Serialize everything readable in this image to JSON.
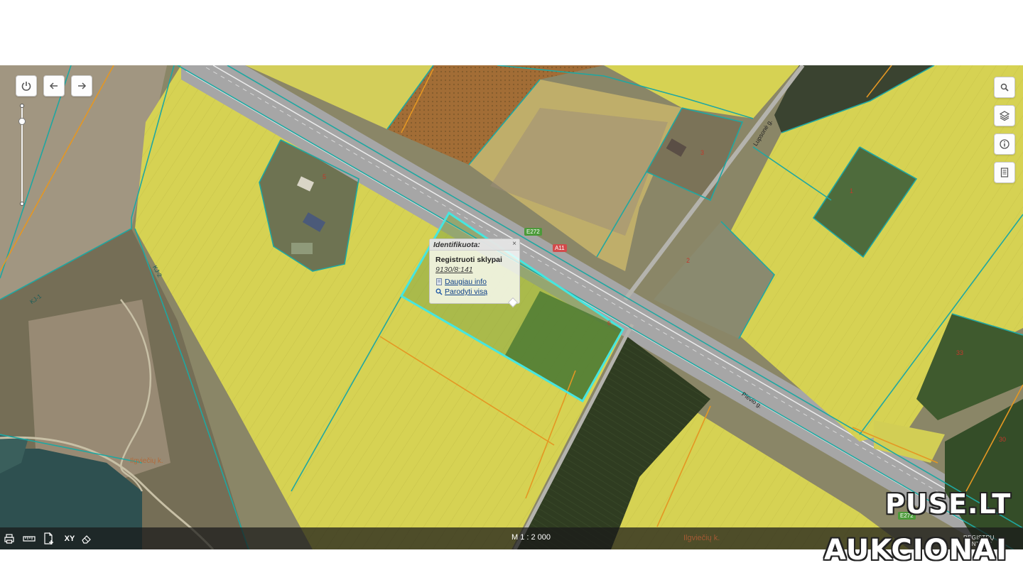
{
  "colors": {
    "canola": "#d6d253",
    "highway": "#a6a6a6",
    "parcel_line": "#1fa7a1",
    "highlight": "#45e6e0",
    "orange_line": "#e49723",
    "water": "#2e5050",
    "dark_field": "#2f3c21"
  },
  "map_controls": {
    "power_icon": "power-icon",
    "back_icon": "arrow-left-icon",
    "forward_icon": "arrow-right-icon",
    "zoom_level": 0.15
  },
  "right_toolbar": {
    "search_icon": "search-icon",
    "layers_icon": "layers-icon",
    "info_icon": "info-icon",
    "legend_icon": "document-icon"
  },
  "popup": {
    "header": "Identifikuota:",
    "close": "×",
    "title": "Registruoti sklypai",
    "parcel_id": "9130/8:141",
    "link_more": "Daugiau info",
    "link_show_all": "Parodyti visą"
  },
  "map_labels": {
    "village": "Ilgviečių k.",
    "road_e272": "E272",
    "road_a11": "A11",
    "road_e272_lower": "E272",
    "street_lupsone": "Lupsonė g.",
    "street_pievio": "Pievio g.",
    "parcel_5": "5",
    "parcel_3": "3",
    "parcel_1": "1",
    "parcel_2": "2",
    "parcel_6": "6",
    "parcel_33": "33",
    "parcel_30": "30",
    "road_kj1": "KJ-1",
    "road_kj2": "KJ-2"
  },
  "bottom_bar": {
    "print_icon": "printer-icon",
    "measure_icon": "ruler-icon",
    "add_doc_icon": "add-document-icon",
    "xy_label": "XY",
    "eraser_icon": "eraser-icon",
    "scale": "M 1 : 2 000",
    "village_label": "Ilgviečių k.",
    "credit": "REGISTRŲ CENTRAS"
  },
  "watermark": {
    "line1": "PUSE.LT",
    "line2": "AUKCIONAI"
  }
}
